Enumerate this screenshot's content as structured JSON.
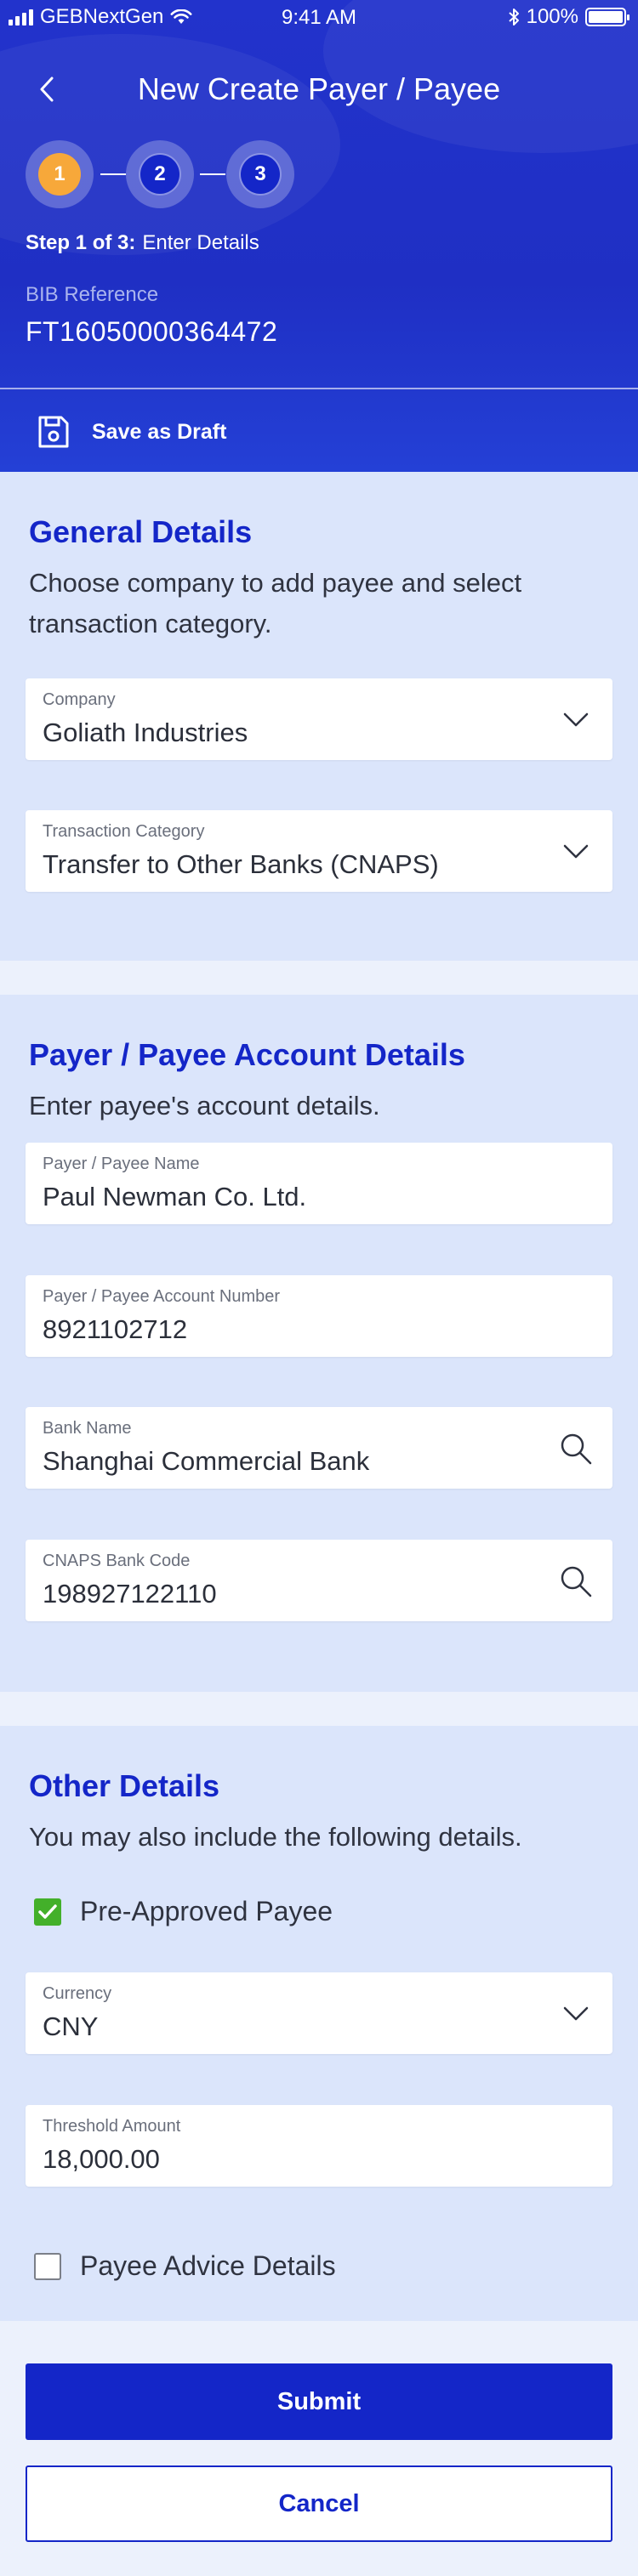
{
  "status_bar": {
    "carrier": "GEBNextGen",
    "time": "9:41 AM",
    "battery": "100%"
  },
  "nav": {
    "title": "New Create Payer / Payee"
  },
  "stepper": {
    "steps": [
      "1",
      "2",
      "3"
    ],
    "active_step": 1,
    "step_prefix": "Step 1 of 3:",
    "step_name": "Enter Details"
  },
  "bib": {
    "label": "BIB Reference",
    "value": "FT16050000364472"
  },
  "draft": {
    "label": "Save as Draft"
  },
  "general": {
    "title": "General Details",
    "description": "Choose company to add payee and select transaction category.",
    "company": {
      "label": "Company",
      "value": "Goliath Industries"
    },
    "category": {
      "label": "Transaction Category",
      "value": "Transfer to Other Banks (CNAPS)"
    }
  },
  "account": {
    "title": "Payer / Payee Account Details",
    "description": "Enter payee's account details.",
    "payee_name": {
      "label": "Payer / Payee Name",
      "value": "Paul Newman Co. Ltd."
    },
    "account_number": {
      "label": "Payer / Payee Account Number",
      "value": "8921102712"
    },
    "bank_name": {
      "label": "Bank Name",
      "value": "Shanghai Commercial Bank"
    },
    "cnaps_code": {
      "label": "CNAPS Bank Code",
      "value": "198927122110"
    }
  },
  "other": {
    "title": "Other Details",
    "description": "You may also include the following details.",
    "pre_approved": {
      "label": "Pre-Approved Payee",
      "checked": true
    },
    "currency": {
      "label": "Currency",
      "value": "CNY"
    },
    "threshold": {
      "label": "Threshold Amount",
      "value": "18,000.00"
    },
    "advice": {
      "label": "Payee Advice Details",
      "checked": false
    }
  },
  "actions": {
    "submit": "Submit",
    "cancel": "Cancel"
  },
  "colors": {
    "primary": "#1426c8",
    "active_step": "#f7a83a",
    "check_green": "#43b02a",
    "background": "#dbe5fb"
  }
}
